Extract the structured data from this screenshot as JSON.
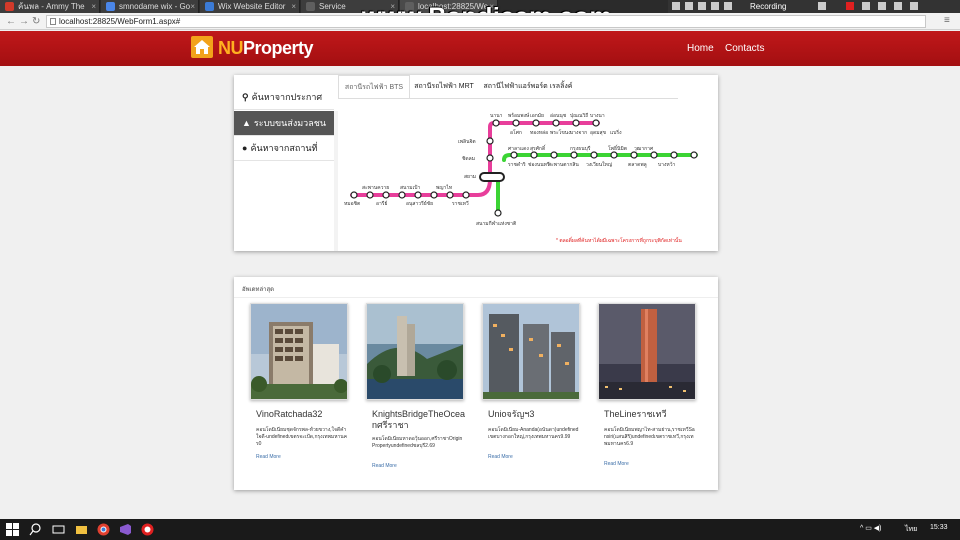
{
  "browser": {
    "tabs": [
      {
        "label": "ค้นพล - Ammy The",
        "color": "#d23a2a"
      },
      {
        "label": "smnodame wix - Go",
        "color": "#4a86e8"
      },
      {
        "label": "Wix Website Editor",
        "color": "#3b7bd6"
      },
      {
        "label": "Service",
        "color": "#5f5f5f"
      },
      {
        "label": "localhost:28825/We",
        "color": "#5f5f5f"
      }
    ],
    "url": "localhost:28825/WebForm1.aspx#",
    "overlay": "www.Bandicam.com",
    "recording_label": "Recording"
  },
  "site": {
    "logo_nu": "NU",
    "logo_rest": "Property",
    "nav": [
      "Home",
      "Contacts"
    ]
  },
  "search": {
    "sidebar": [
      {
        "icon": "search-icon",
        "label": "ค้นหาจากประกาศ"
      },
      {
        "icon": "train-icon",
        "label": "ระบบขนส่งมวลชน"
      },
      {
        "icon": "map-pin-icon",
        "label": "ค้นหาจากสถานที่"
      }
    ],
    "tabs": [
      "สถานีรถไฟฟ้า BTS",
      "สถานีรถไฟฟ้า MRT",
      "สถานีไฟฟ้าแอร์พอร์ต เรลลิ้งค์"
    ],
    "line_colors": {
      "sukhumvit": "#e83e9b",
      "silom": "#3bd434",
      "interchange": "#222222"
    },
    "stations": {
      "top_row_upper": [
        "นานา",
        "พร้อมพงษ์",
        "เอกมัย",
        "อ่อนนุช",
        "ปุณณวิถี",
        "บางนา"
      ],
      "top_row_lower": [
        "อโศก",
        "ทองหล่อ",
        "พระโขนง",
        "บางจาก",
        "อุดมสุข",
        "แบริ่ง"
      ],
      "left_column": [
        "เพลินจิต",
        "ชิดลม",
        "สยาม"
      ],
      "middle_row_upper": [
        "ศาลาแดง",
        "สุรศักดิ์",
        "กรุงธนบุรี",
        "โพธิ์นิมิต",
        "วงเวียนใหญ่"
      ],
      "middle_row_upper_extra": "วุฒากาศ",
      "middle_row_lower": [
        "ราชดำริ",
        "ช่องนนทรี",
        "สะพานตากสิน",
        "วงเวียนใหญ่",
        "ตลาดพลู",
        "บางหว้า"
      ],
      "bottom_row_upper": [
        "สะพานควาย",
        "สนามเป้า",
        "พญาไท"
      ],
      "bottom_row_lower": [
        "หมอชิต",
        "อารีย์",
        "อนุสาวรีย์ชัย",
        "ราชเทวี"
      ],
      "stadium": "สนามกีฬาแห่งชาติ"
    },
    "note": "* ตลอดิ์ผลที่ค้นหาได้ผมีเฉพาะโครงการที่ถูกระบุพิกัดเท่านั้น"
  },
  "listings": {
    "title": "อัพเดทล่าสุด",
    "items": [
      {
        "name": "VinoRatchada32",
        "desc": "คอนโดมิเนียมชุดจักรพล-ห้วยขวาง,ใจดีคำใจดี-undefinedเขตรจะเป้ด,กรุงเทพมหานคร0",
        "more": "Read More"
      },
      {
        "name": "KnightsBridgeTheOceanศรีราชา",
        "desc": "คอนโดมิเนียมหาดอวุ้นออก,ศรีราชาOriginPropertyundefinedชลบุรี2.69",
        "more": "Read More"
      },
      {
        "name": "Unioจรัญฯ3",
        "desc": "คอนโดมิเนียม-Ananda(อนันดา)undefinedเขตบางกอกใหญ่,กรุงเทพมหานคร9.99",
        "more": "Read More"
      },
      {
        "name": "TheLineราชเทวี",
        "desc": "คอนโดมิเนียมพญาไท-สามย่าน,ราชเทวีSansiri(แสนสิริ)undefinedเขตราชเทวี,กรุงเทพมหานคร6.9",
        "more": "Read More"
      }
    ]
  },
  "taskbar": {
    "lang": "ไทย",
    "time": "15:33"
  }
}
